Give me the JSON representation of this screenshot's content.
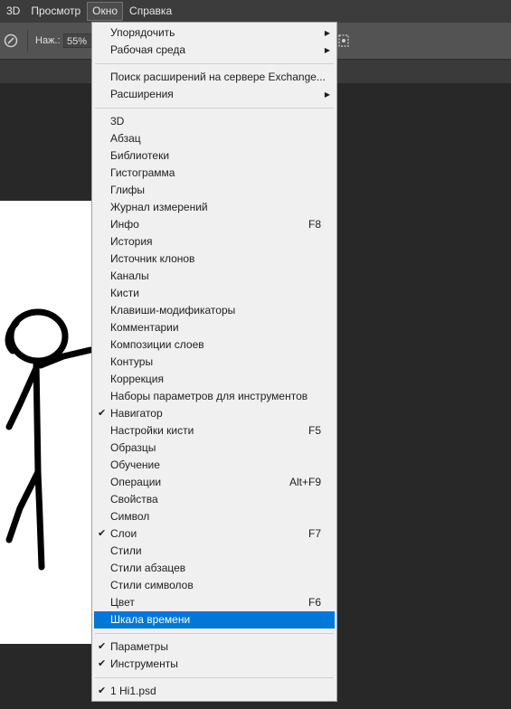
{
  "menubar": {
    "items": [
      "3D",
      "Просмотр",
      "Окно",
      "Справка"
    ]
  },
  "options": {
    "pressure_label": "Наж.:",
    "pressure_value": "55%"
  },
  "window_menu": {
    "sections": [
      [
        {
          "label": "Упорядочить",
          "submenu": true
        },
        {
          "label": "Рабочая среда",
          "submenu": true
        }
      ],
      [
        {
          "label": "Поиск расширений на сервере Exchange..."
        },
        {
          "label": "Расширения",
          "submenu": true
        }
      ],
      [
        {
          "label": "3D"
        },
        {
          "label": "Абзац"
        },
        {
          "label": "Библиотеки"
        },
        {
          "label": "Гистограмма"
        },
        {
          "label": "Глифы"
        },
        {
          "label": "Журнал измерений"
        },
        {
          "label": "Инфо",
          "shortcut": "F8"
        },
        {
          "label": "История"
        },
        {
          "label": "Источник клонов"
        },
        {
          "label": "Каналы"
        },
        {
          "label": "Кисти"
        },
        {
          "label": "Клавиши-модификаторы"
        },
        {
          "label": "Комментарии"
        },
        {
          "label": "Композиции слоев"
        },
        {
          "label": "Контуры"
        },
        {
          "label": "Коррекция"
        },
        {
          "label": "Наборы параметров для инструментов"
        },
        {
          "label": "Навигатор",
          "checked": true
        },
        {
          "label": "Настройки кисти",
          "shortcut": "F5"
        },
        {
          "label": "Образцы"
        },
        {
          "label": "Обучение"
        },
        {
          "label": "Операции",
          "shortcut": "Alt+F9"
        },
        {
          "label": "Свойства"
        },
        {
          "label": "Символ"
        },
        {
          "label": "Слои",
          "shortcut": "F7",
          "checked": true
        },
        {
          "label": "Стили"
        },
        {
          "label": "Стили абзацев"
        },
        {
          "label": "Стили символов"
        },
        {
          "label": "Цвет",
          "shortcut": "F6"
        },
        {
          "label": "Шкала времени",
          "highlighted": true
        }
      ],
      [
        {
          "label": "Параметры",
          "checked": true
        },
        {
          "label": "Инструменты",
          "checked": true
        }
      ],
      [
        {
          "label": "1 Hi1.psd",
          "checked": true
        }
      ]
    ]
  }
}
